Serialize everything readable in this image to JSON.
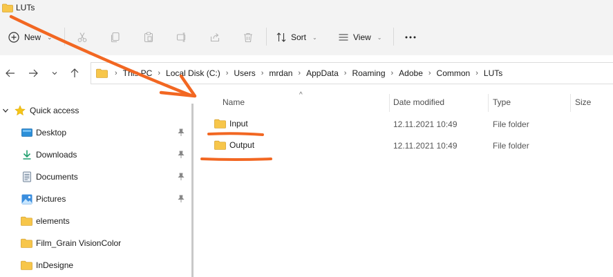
{
  "window": {
    "title": "LUTs"
  },
  "toolbar": {
    "new_label": "New",
    "sort_label": "Sort",
    "view_label": "View",
    "more_label": "···"
  },
  "breadcrumbs": [
    "This PC",
    "Local Disk (C:)",
    "Users",
    "mrdan",
    "AppData",
    "Roaming",
    "Adobe",
    "Common",
    "LUTs"
  ],
  "sidebar": {
    "quick_access": "Quick access",
    "items": [
      {
        "label": "Desktop",
        "icon": "desktop-icon",
        "pinned": true
      },
      {
        "label": "Downloads",
        "icon": "downloads-icon",
        "pinned": true
      },
      {
        "label": "Documents",
        "icon": "documents-icon",
        "pinned": true
      },
      {
        "label": "Pictures",
        "icon": "pictures-icon",
        "pinned": true
      },
      {
        "label": "elements",
        "icon": "folder-icon",
        "pinned": false
      },
      {
        "label": "Film_Grain VisionColor",
        "icon": "folder-icon",
        "pinned": false
      },
      {
        "label": "InDesigne",
        "icon": "folder-icon",
        "pinned": false
      }
    ]
  },
  "columns": {
    "name": "Name",
    "date": "Date modified",
    "type": "Type",
    "size": "Size"
  },
  "files": [
    {
      "name": "Input",
      "date": "12.11.2021 10:49",
      "type": "File folder"
    },
    {
      "name": "Output",
      "date": "12.11.2021 10:49",
      "type": "File folder"
    }
  ],
  "colors": {
    "annotation": "#f26722",
    "folder": "#f7c64a",
    "accent": "#0067c0"
  }
}
